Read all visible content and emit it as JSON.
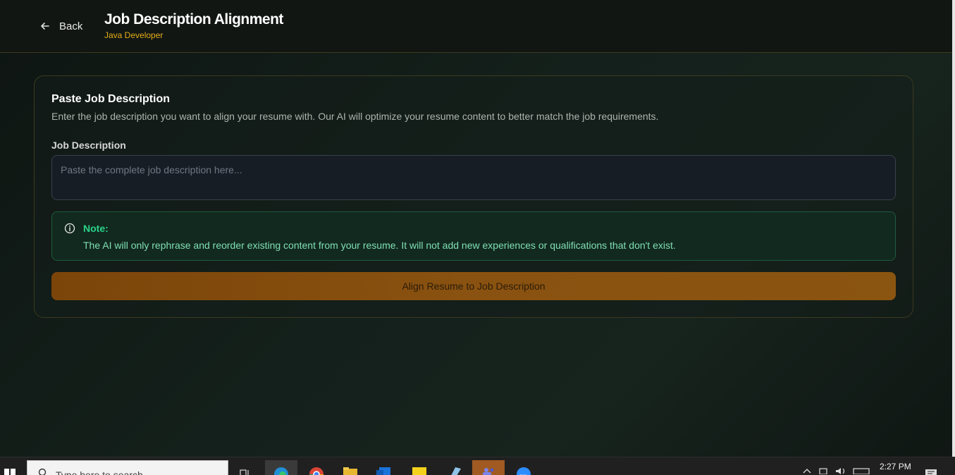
{
  "header": {
    "back_label": "Back",
    "title": "Job Description Alignment",
    "subtitle": "Java Developer"
  },
  "card": {
    "title": "Paste Job Description",
    "description": "Enter the job description you want to align your resume with. Our AI will optimize your resume content to better match the job requirements.",
    "field_label": "Job Description",
    "input_value": "",
    "input_placeholder": "Paste the complete job description here...",
    "note": {
      "title": "Note:",
      "text": "The AI will only rephrase and reorder existing content from your resume. It will not add new experiences or qualifications that don't exist."
    },
    "action_label": "Align Resume to Job Description"
  },
  "taskbar": {
    "search_placeholder": "Type here to search",
    "clock": "2:27 PM",
    "apps": [
      "task-view-icon",
      "edge-icon",
      "chrome-icon",
      "file-explorer-icon",
      "outlook-icon",
      "sticky-notes-icon",
      "notepad-icon",
      "teams-icon",
      "zoom-icon"
    ]
  },
  "colors": {
    "accent": "#e5ad16",
    "note_green": "#2bd48a",
    "button_orange": "#8a5210"
  }
}
